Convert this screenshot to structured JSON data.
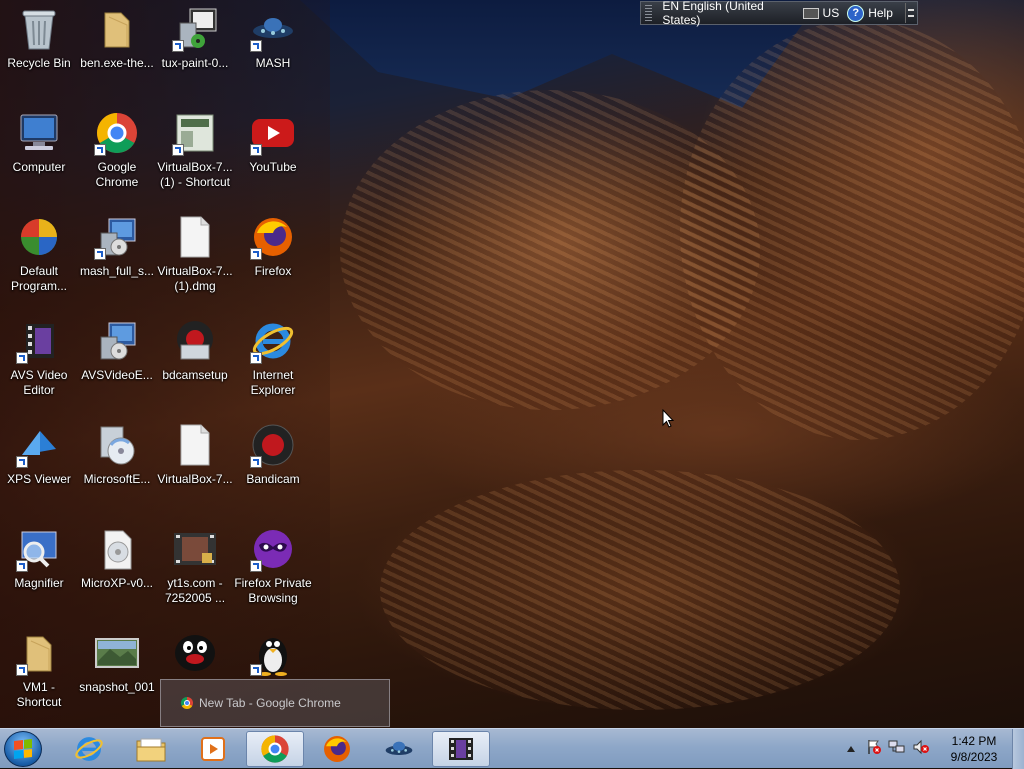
{
  "desktop": {
    "icons": [
      {
        "label": "Recycle Bin",
        "icon": "recycle-bin-icon"
      },
      {
        "label": "ben.exe-the...",
        "icon": "folder-icon"
      },
      {
        "label": "tux-paint-0...",
        "icon": "tux-paint-installer-icon"
      },
      {
        "label": "MASH",
        "icon": "mash-ufo-icon"
      },
      {
        "label": "Computer",
        "icon": "computer-icon"
      },
      {
        "label": "Google Chrome",
        "icon": "chrome-icon"
      },
      {
        "label": "VirtualBox-7... (1) - Shortcut",
        "icon": "virtualbox-shortcut-icon"
      },
      {
        "label": "YouTube",
        "icon": "youtube-icon"
      },
      {
        "label": "Default Program...",
        "icon": "default-programs-icon"
      },
      {
        "label": "mash_full_s...",
        "icon": "installer-icon"
      },
      {
        "label": "VirtualBox-7... (1).dmg",
        "icon": "file-icon"
      },
      {
        "label": "Firefox",
        "icon": "firefox-icon"
      },
      {
        "label": "AVS Video Editor",
        "icon": "avs-video-editor-icon"
      },
      {
        "label": "AVSVideoE...",
        "icon": "installer-icon"
      },
      {
        "label": "bdcamsetup",
        "icon": "bandicam-setup-icon"
      },
      {
        "label": "Internet Explorer",
        "icon": "internet-explorer-icon"
      },
      {
        "label": "XPS Viewer",
        "icon": "xps-viewer-icon"
      },
      {
        "label": "MicrosoftE...",
        "icon": "disc-installer-icon"
      },
      {
        "label": "VirtualBox-7...",
        "icon": "file-icon"
      },
      {
        "label": "Bandicam",
        "icon": "bandicam-icon"
      },
      {
        "label": "Magnifier",
        "icon": "magnifier-icon"
      },
      {
        "label": "MicroXP-v0...",
        "icon": "disc-image-icon"
      },
      {
        "label": "yt1s.com - 7252005 ...",
        "icon": "video-file-icon"
      },
      {
        "label": "Firefox Private Browsing",
        "icon": "firefox-private-icon"
      },
      {
        "label": "VM1 - Shortcut",
        "icon": "folder-icon"
      },
      {
        "label": "snapshot_001",
        "icon": "image-file-icon"
      },
      {
        "label": "",
        "icon": "pingu-icon"
      },
      {
        "label": "",
        "icon": "tux-icon"
      }
    ]
  },
  "language_bar": {
    "language": "EN English (United States)",
    "keyboard": "US",
    "help": "Help"
  },
  "taskbar": {
    "thumbnail_title": "New Tab - Google Chrome",
    "pinned": [
      {
        "icon": "internet-explorer-icon"
      },
      {
        "icon": "explorer-folder-icon"
      },
      {
        "icon": "media-player-icon"
      },
      {
        "icon": "chrome-icon",
        "active": true
      },
      {
        "icon": "firefox-icon"
      },
      {
        "icon": "mash-ufo-icon"
      },
      {
        "icon": "movie-maker-icon",
        "active": true
      }
    ],
    "clock_time": "1:42 PM",
    "clock_date": "9/8/2023"
  },
  "colors": {
    "taskbar": "#8ea7c8",
    "start_orb": "#1a5ea8",
    "label_text": "#ffffff"
  }
}
